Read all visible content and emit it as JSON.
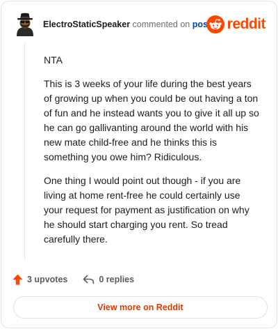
{
  "header": {
    "username": "ElectroStaticSpeaker",
    "meta_text": "commented on",
    "post_link": "post",
    "brand": "reddit"
  },
  "comment": {
    "paragraphs": [
      "NTA",
      "This is 3 weeks of your life during the best years of growing up when you could be out having a ton of fun and he instead wants you to give it all up so he can go gallivanting around the world with his new mate child-free and he thinks this is something you owe him? Ridiculous.",
      "One thing I would point out though - if you are living at home rent-free he could certainly use your request for payment as justification on why he should start charging you rent. So tread carefully there."
    ]
  },
  "actions": {
    "upvotes": "3 upvotes",
    "replies": "0 replies"
  },
  "footer": {
    "view_more": "View more on Reddit"
  },
  "colors": {
    "brand": "#ff4500",
    "link": "#0045ac",
    "upvote": "#d93a00"
  },
  "icons": [
    "avatar-icon",
    "reddit-logo-icon",
    "upvote-arrow-icon",
    "reply-arrow-icon"
  ]
}
